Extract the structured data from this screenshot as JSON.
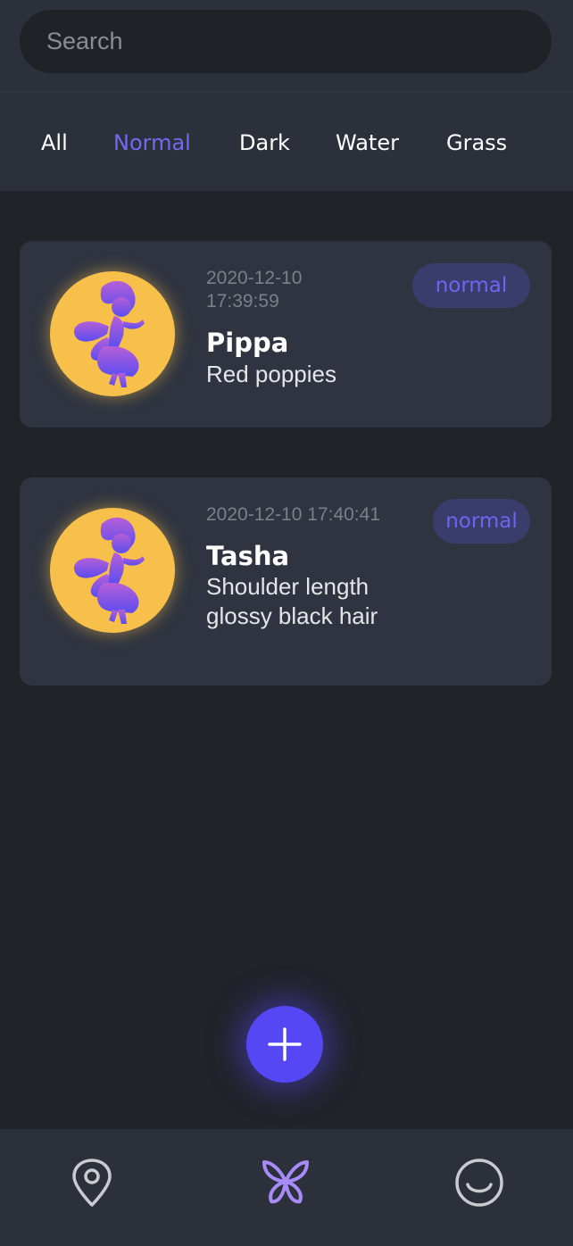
{
  "search": {
    "placeholder": "Search"
  },
  "tabs": [
    {
      "label": "All",
      "active": false
    },
    {
      "label": "Normal",
      "active": true
    },
    {
      "label": "Dark",
      "active": false
    },
    {
      "label": "Water",
      "active": false
    },
    {
      "label": "Grass",
      "active": false
    }
  ],
  "cards": [
    {
      "timestamp": "2020-12-10 17:39:59",
      "name": "Pippa",
      "description": "Red poppies",
      "badge": "normal",
      "icon": "fairy-avatar-icon"
    },
    {
      "timestamp": "2020-12-10 17:40:41",
      "name": "Tasha",
      "description": "Shoulder length glossy black hair",
      "badge": "normal",
      "icon": "fairy-avatar-icon"
    }
  ],
  "fab": {
    "icon": "plus-icon"
  },
  "nav": [
    {
      "icon": "location-pin-icon",
      "active": false
    },
    {
      "icon": "butterfly-icon",
      "active": true
    },
    {
      "icon": "smiley-icon",
      "active": false
    }
  ],
  "colors": {
    "background": "#212329",
    "header": "#2b303a",
    "card": "#2f3440",
    "accent": "#5647f5",
    "active_tab": "#7468ef",
    "badge_bg": "#3a3d6b",
    "badge_text": "#6e64f2",
    "avatar": "#f7c04a",
    "nav_active": "#a68af5",
    "nav_inactive": "#c9cbd0"
  }
}
